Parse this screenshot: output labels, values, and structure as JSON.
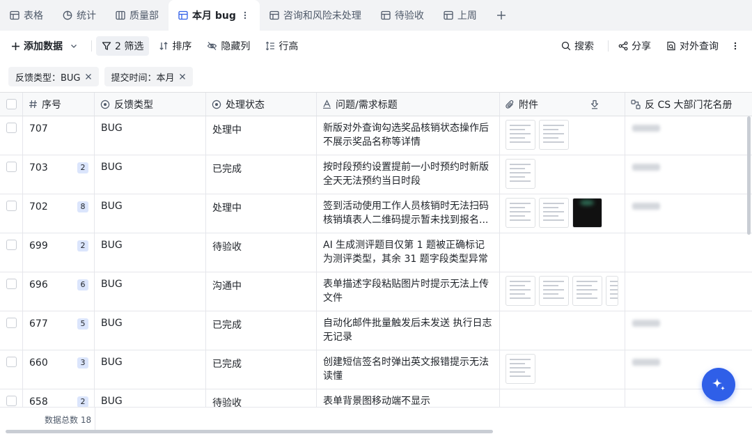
{
  "tabs": [
    {
      "label": "表格",
      "icon": "grid-icon",
      "active": false
    },
    {
      "label": "统计",
      "icon": "pie-chart-icon",
      "active": false
    },
    {
      "label": "质量部",
      "icon": "board-icon",
      "active": false
    },
    {
      "label": "本月 bug",
      "icon": "grid-icon",
      "active": true
    },
    {
      "label": "咨询和风险未处理",
      "icon": "grid-icon",
      "active": false
    },
    {
      "label": "待验收",
      "icon": "grid-icon",
      "active": false
    },
    {
      "label": "上周",
      "icon": "grid-icon",
      "active": false
    }
  ],
  "toolbar": {
    "add_label": "添加数据",
    "filter_label": "2 筛选",
    "sort_label": "排序",
    "hide_label": "隐藏列",
    "row_height_label": "行高",
    "search_label": "搜索",
    "share_label": "分享",
    "query_label": "对外查询"
  },
  "filters": [
    {
      "label": "反馈类型：BUG"
    },
    {
      "label": "提交时间：本月"
    }
  ],
  "columns": {
    "id": "序号",
    "type": "反馈类型",
    "status": "处理状态",
    "title": "问题/需求标题",
    "attachment": "附件",
    "cs": "反 CS 大部门花名册"
  },
  "rows": [
    {
      "id": "707",
      "badge": "",
      "type": "BUG",
      "status": "处理中",
      "title": "新版对外查询勾选奖品核销状态操作后不展示奖品名称等详情",
      "attachments": 2,
      "cs_blurred": true
    },
    {
      "id": "703",
      "badge": "2",
      "type": "BUG",
      "status": "已完成",
      "title": "按时段预约设置提前一小时预约时新版全天无法预约当日时段",
      "attachments": 1,
      "cs_blurred": true
    },
    {
      "id": "702",
      "badge": "8",
      "type": "BUG",
      "status": "处理中",
      "title": "签到活动使用工作人员核销时无法扫码核销填表人二维码提示暂未找到报名...",
      "attachments": 3,
      "cs_blurred": true
    },
    {
      "id": "699",
      "badge": "2",
      "type": "BUG",
      "status": "待验收",
      "title": "AI 生成测评题目仅第 1 题被正确标记为测评类型，其余 31 题字段类型异常",
      "attachments": 0,
      "cs_blurred": false
    },
    {
      "id": "696",
      "badge": "6",
      "type": "BUG",
      "status": "沟通中",
      "title": "表单描述字段粘贴图片时提示无法上传文件",
      "attachments": 4,
      "cs_blurred": false
    },
    {
      "id": "677",
      "badge": "5",
      "type": "BUG",
      "status": "已完成",
      "title": "自动化邮件批量触发后未发送 执行日志无记录",
      "attachments": 0,
      "cs_blurred": true
    },
    {
      "id": "660",
      "badge": "3",
      "type": "BUG",
      "status": "已完成",
      "title": "创建短信签名时弹出英文报错提示无法读懂",
      "attachments": 1,
      "cs_blurred": true
    },
    {
      "id": "658",
      "badge": "2",
      "type": "BUG",
      "status": "待验收",
      "title": "表单背景图移动端不显示",
      "attachments": 0,
      "cs_blurred": false
    }
  ],
  "footer": {
    "total_label": "数据总数 18"
  },
  "colors": {
    "accent": "#2f5fe8",
    "badge_bg": "#dbe5fc",
    "tab_bg": "#f2f3f5"
  }
}
